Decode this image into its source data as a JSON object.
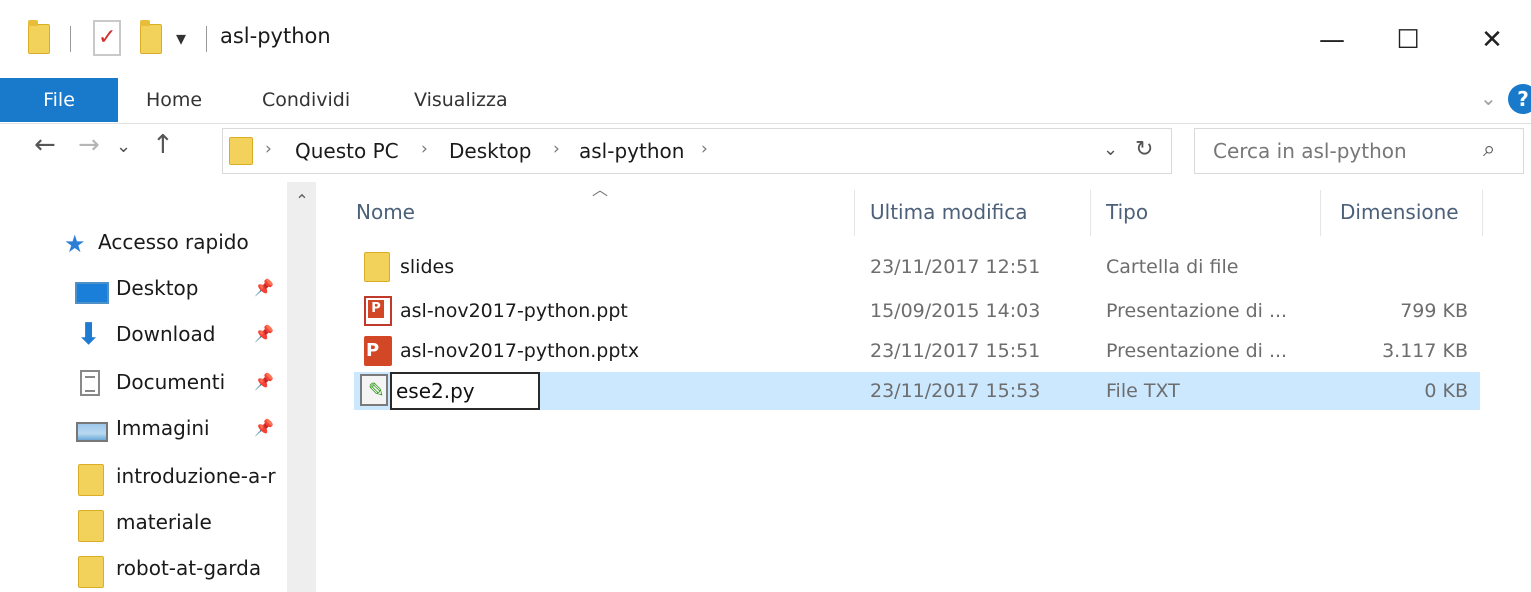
{
  "window": {
    "title": "asl-python",
    "qa_dropdown": "▾",
    "minimize": "—",
    "maximize": "☐",
    "close": "✕"
  },
  "ribbon": {
    "file": "File",
    "tabs": [
      "Home",
      "Condividi",
      "Visualizza"
    ],
    "expand": "⌄",
    "help": "?"
  },
  "nav": {
    "back": "←",
    "forward": "→",
    "recent": "⌄",
    "up": "↑"
  },
  "address": {
    "crumbs": [
      "Questo PC",
      "Desktop",
      "asl-python"
    ],
    "separator": "›",
    "dropdown": "⌄",
    "refresh": "↻"
  },
  "search": {
    "placeholder": "Cerca in asl-python",
    "icon": "⌕"
  },
  "sidebar": {
    "scroll_up": "⌃",
    "pin": "📌",
    "quick_access": "Accesso rapido",
    "items": [
      {
        "label": "Desktop",
        "pinned": true
      },
      {
        "label": "Download",
        "pinned": true
      },
      {
        "label": "Documenti",
        "pinned": true
      },
      {
        "label": "Immagini",
        "pinned": true
      },
      {
        "label": "introduzione-a-r",
        "pinned": false
      },
      {
        "label": "materiale",
        "pinned": false
      },
      {
        "label": "robot-at-garda",
        "pinned": false
      }
    ]
  },
  "list": {
    "sort_indicator": "︿",
    "columns": {
      "name": "Nome",
      "modified": "Ultima modifica",
      "type": "Tipo",
      "size": "Dimensione"
    },
    "rows": [
      {
        "name": "slides",
        "modified": "23/11/2017 12:51",
        "type": "Cartella di file",
        "size": "",
        "icon": "folder-icon"
      },
      {
        "name": "asl-nov2017-python.ppt",
        "modified": "15/09/2015 14:03",
        "type": "Presentazione di ...",
        "size": "799 KB",
        "icon": "ppt-icon"
      },
      {
        "name": "asl-nov2017-python.pptx",
        "modified": "23/11/2017 15:51",
        "type": "Presentazione di ...",
        "size": "3.117 KB",
        "icon": "pptx-icon"
      },
      {
        "name": "ese2.py",
        "modified": "23/11/2017 15:53",
        "type": "File TXT",
        "size": "0 KB",
        "icon": "text-file-icon"
      }
    ]
  },
  "colors": {
    "accent": "#1979ca",
    "selection": "#cce8ff",
    "folder": "#f3d25b"
  }
}
